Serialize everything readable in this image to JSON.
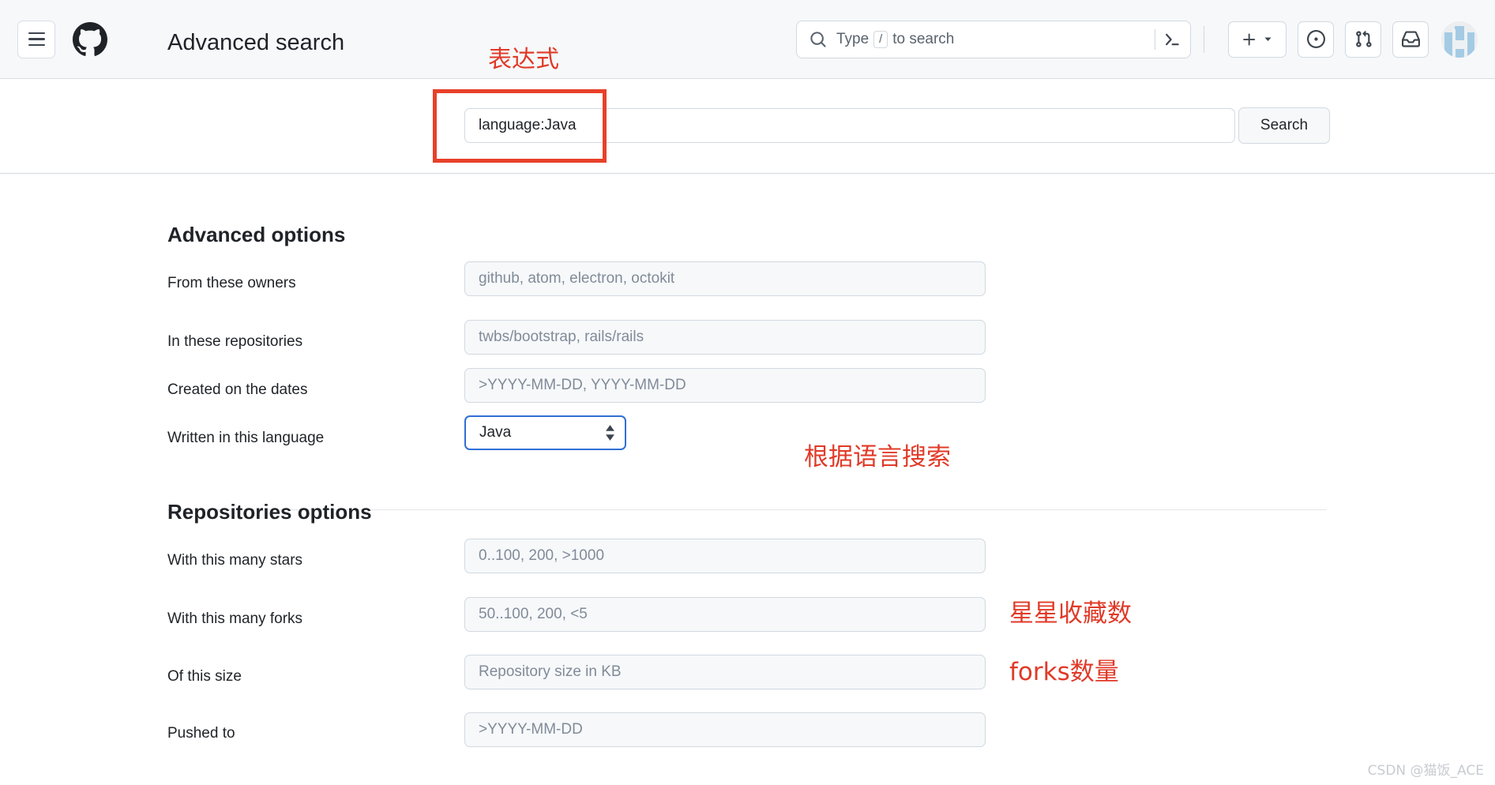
{
  "header": {
    "menu_label": "Open global navigation menu",
    "logo_name": "GitHub",
    "search": {
      "placeholder_prefix": "Type",
      "slash_key": "/",
      "placeholder_suffix": "to search"
    },
    "actions": [
      {
        "name": "create-new-button",
        "label": "Create new…"
      },
      {
        "name": "issues-button",
        "label": "Issues"
      },
      {
        "name": "pull-requests-button",
        "label": "Pull requests"
      },
      {
        "name": "notifications-button",
        "label": "Inbox"
      }
    ],
    "avatar_label": "Your profile"
  },
  "search_row": {
    "title": "Advanced search",
    "query_value": "language:Java",
    "query_placeholder": "",
    "submit_label": "Search"
  },
  "advanced_options": {
    "heading": "Advanced options",
    "fields": [
      {
        "label": "From these owners",
        "placeholder": "github, atom, electron, octokit",
        "type": "text"
      },
      {
        "label": "In these repositories",
        "placeholder": "twbs/bootstrap, rails/rails",
        "type": "text"
      },
      {
        "label": "Created on the dates",
        "placeholder": ">YYYY-MM-DD, YYYY-MM-DD",
        "type": "text"
      },
      {
        "label": "Written in this language",
        "value": "Java",
        "type": "select"
      }
    ]
  },
  "repositories_options": {
    "heading": "Repositories options",
    "fields": [
      {
        "label": "With this many stars",
        "placeholder": "0..100, 200, >1000",
        "type": "text"
      },
      {
        "label": "With this many forks",
        "placeholder": "50..100, 200, <5",
        "type": "text"
      },
      {
        "label": "Of this size",
        "placeholder": "Repository size in KB",
        "type": "text"
      },
      {
        "label": "Pushed to",
        "placeholder": ">YYYY-MM-DD",
        "type": "text"
      }
    ]
  },
  "annotations": {
    "expression": "表达式",
    "language_search": "根据语言搜索",
    "stars_count": "星星收藏数",
    "forks_count": "forks数量",
    "accent_color": "#e8402a"
  },
  "watermark": "CSDN @猫饭_ACE"
}
